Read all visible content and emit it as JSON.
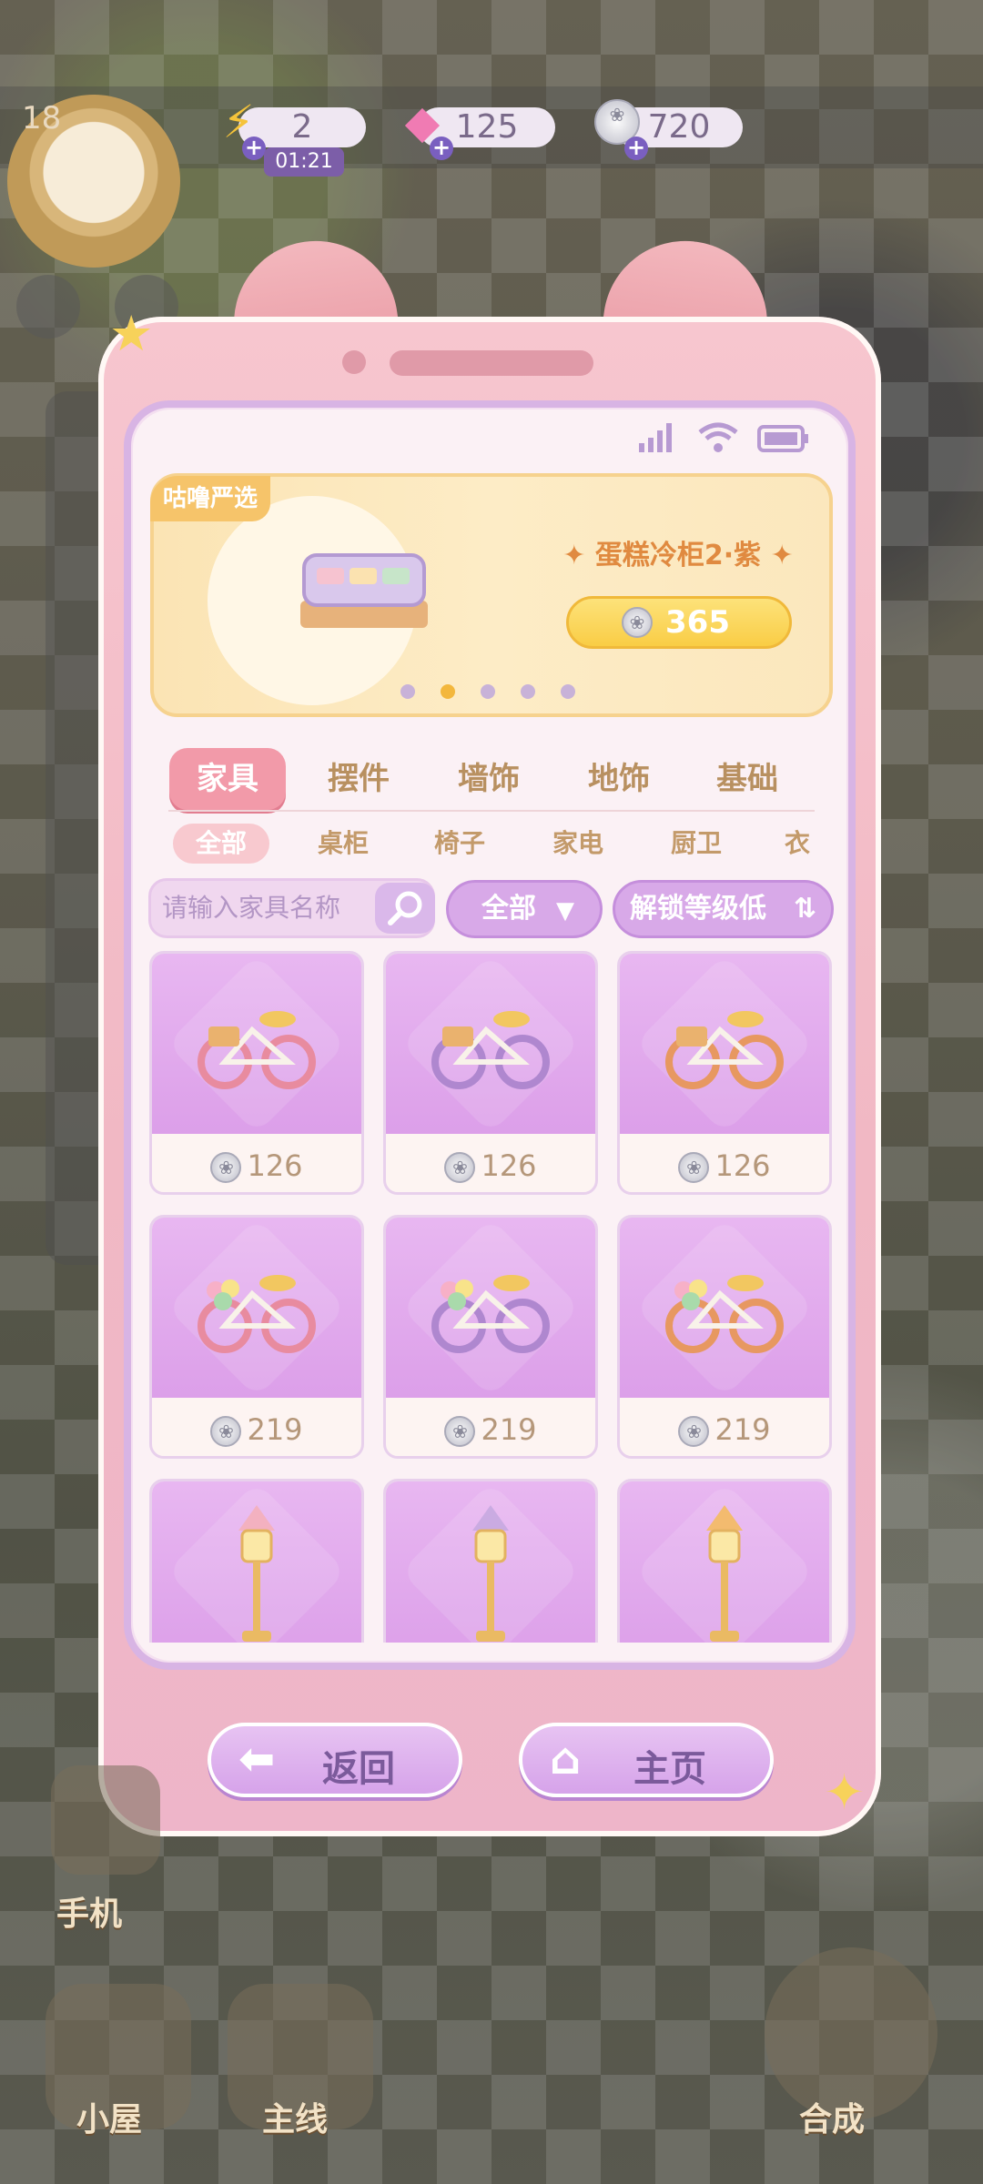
{
  "resources": {
    "level": "18",
    "energy": "2",
    "energy_timer": "01:21",
    "gems": "125",
    "coins": "720"
  },
  "phone": {
    "banner": {
      "tag": "咕噜严选",
      "item_name": "✦ 蛋糕冷柜2·紫 ✦",
      "price": "365",
      "page_index": 1,
      "page_count": 5
    },
    "tabs": [
      {
        "label": "家具",
        "active": true
      },
      {
        "label": "摆件",
        "active": false
      },
      {
        "label": "墙饰",
        "active": false
      },
      {
        "label": "地饰",
        "active": false
      },
      {
        "label": "基础",
        "active": false
      }
    ],
    "subtabs": [
      {
        "label": "全部",
        "active": true
      },
      {
        "label": "桌柜",
        "active": false
      },
      {
        "label": "椅子",
        "active": false
      },
      {
        "label": "家电",
        "active": false
      },
      {
        "label": "厨卫",
        "active": false
      },
      {
        "label": "衣",
        "active": false
      }
    ],
    "search": {
      "placeholder": "请输入家具名称"
    },
    "filter": {
      "value": "全部"
    },
    "sort": {
      "label": "解锁等级低"
    },
    "items": [
      {
        "price": "126",
        "icon": "bicycle-pink"
      },
      {
        "price": "126",
        "icon": "bicycle-purple"
      },
      {
        "price": "126",
        "icon": "bicycle-orange"
      },
      {
        "price": "219",
        "icon": "bicycle-pink-flowers"
      },
      {
        "price": "219",
        "icon": "bicycle-purple-flowers"
      },
      {
        "price": "219",
        "icon": "bicycle-orange-flowers"
      },
      {
        "price": "",
        "icon": "streetlamp-pink"
      },
      {
        "price": "",
        "icon": "streetlamp-purple"
      },
      {
        "price": "",
        "icon": "streetlamp-orange"
      }
    ],
    "buttons": {
      "back": "返回",
      "home": "主页"
    }
  },
  "bottom_nav": {
    "house": "小屋",
    "main_quest": "主线",
    "merge": "合成",
    "phone": "手机"
  },
  "colors": {
    "accent_pink": "#f29aa9",
    "accent_purple": "#d8a9e8",
    "gold": "#f9cd45"
  }
}
